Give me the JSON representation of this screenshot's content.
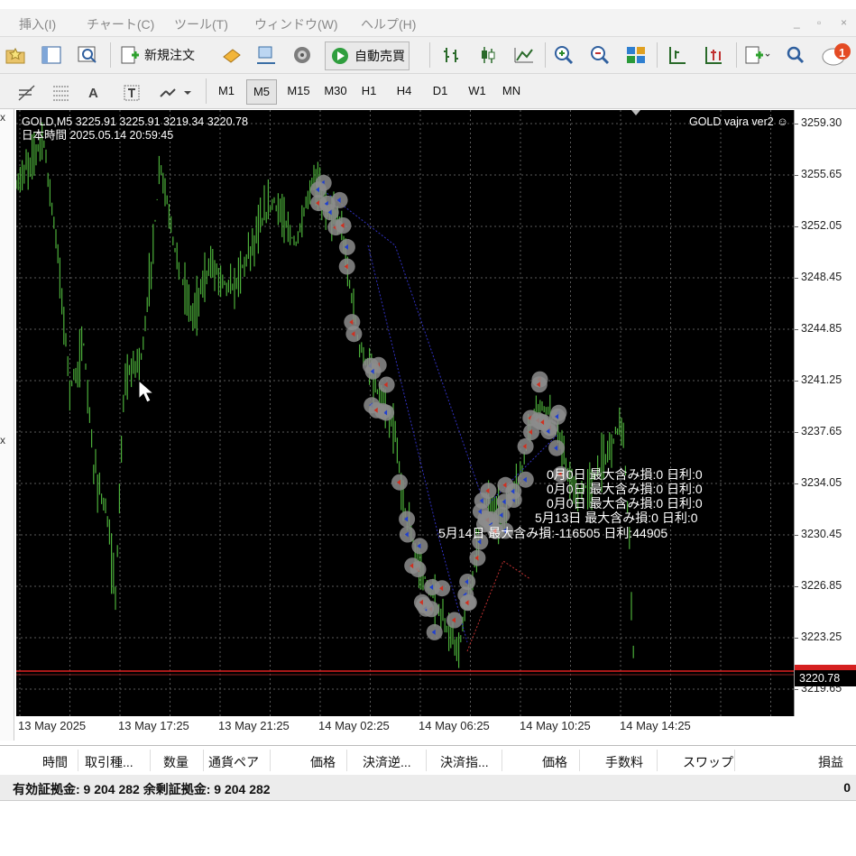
{
  "menu": {
    "items": [
      "挿入(I)",
      "チャート(C)",
      "ツール(T)",
      "ウィンドウ(W)",
      "ヘルプ(H)"
    ],
    "window_buttons": [
      "_",
      "▫",
      "×"
    ]
  },
  "toolbar": {
    "new_order_label": "新規注文",
    "auto_trading_label": "自動売買",
    "notification_count": "1"
  },
  "timeframes": [
    "M1",
    "M5",
    "M15",
    "M30",
    "H1",
    "H4",
    "D1",
    "W1",
    "MN"
  ],
  "active_timeframe": "M5",
  "chart": {
    "info_line1": "GOLD,M5  3225.91 3225.91 3219.34 3220.78",
    "info_line2": "日本時間 2025.05.14 20:59:45",
    "ea_name": "GOLD vajra ver2 ☺",
    "stats": [
      "0月0日  最大含み損:0  日利:0",
      "0月0日  最大含み損:0  日利:0",
      "0月0日  最大含み損:0  日利:0",
      "5月13日  最大含み損:0  日利:0",
      "5月14日  最大含み損:-116505  日利:44905"
    ],
    "current_price": "3220.78",
    "price_ticks": [
      "3259.30",
      "3255.65",
      "3252.05",
      "3248.45",
      "3244.85",
      "3241.25",
      "3237.65",
      "3234.05",
      "3230.45",
      "3226.85",
      "3223.25",
      "3219.65"
    ],
    "time_ticks": [
      "13 May 2025",
      "13 May 17:25",
      "13 May 21:25",
      "14 May 02:25",
      "14 May 06:25",
      "14 May 10:25",
      "14 May 14:25"
    ],
    "colors": {
      "background": "#000000",
      "candles": "#4caf3a",
      "grid": "#5a5a5a",
      "bid_line": "#e02020",
      "trade_marker": "#8c8c8c"
    }
  },
  "terminal": {
    "columns": [
      "時間",
      "取引種...",
      "数量",
      "通貨ペア",
      "価格",
      "決済逆...",
      "決済指...",
      "価格",
      "手数料",
      "スワップ",
      "損益"
    ],
    "summary": "有効証拠金: 9 204 282  余剰証拠金: 9 204 282",
    "summary_value": "0"
  }
}
